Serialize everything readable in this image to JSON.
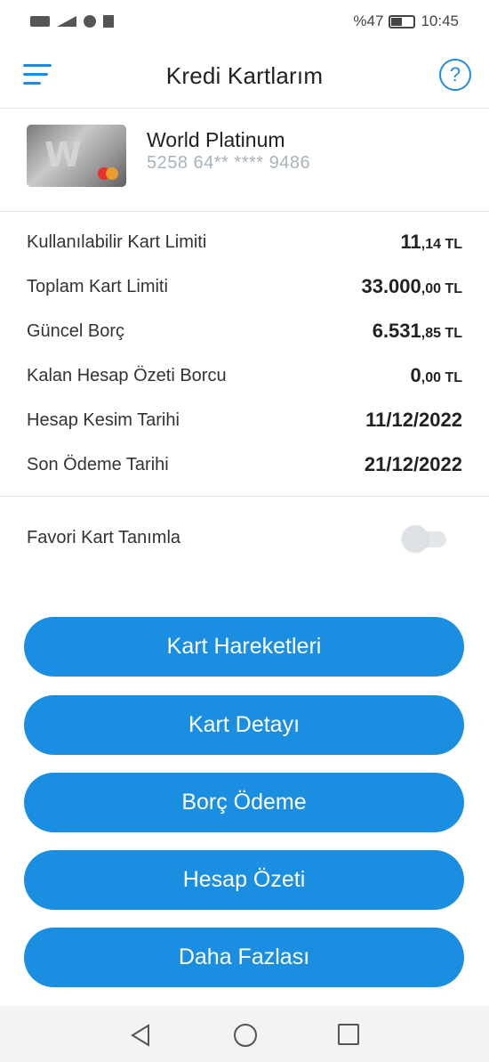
{
  "status_bar": {
    "battery": "%47",
    "time": "10:45"
  },
  "header": {
    "title": "Kredi Kartlarım",
    "help_symbol": "?"
  },
  "card": {
    "name": "World Platinum",
    "number": "5258 64** **** 9486"
  },
  "details": [
    {
      "label": "Kullanılabilir Kart Limiti",
      "main": "11",
      "small": ",14 TL"
    },
    {
      "label": "Toplam Kart Limiti",
      "main": "33.000",
      "small": ",00 TL"
    },
    {
      "label": "Güncel Borç",
      "main": "6.531",
      "small": ",85 TL"
    },
    {
      "label": "Kalan Hesap Özeti Borcu",
      "main": "0",
      "small": ",00 TL"
    },
    {
      "label": "Hesap Kesim Tarihi",
      "main": "11/12/2022",
      "small": ""
    },
    {
      "label": "Son Ödeme Tarihi",
      "main": "21/12/2022",
      "small": ""
    }
  ],
  "favorite": {
    "label": "Favori Kart Tanımla",
    "enabled": false
  },
  "actions": {
    "card_transactions": "Kart Hareketleri",
    "card_detail": "Kart Detayı",
    "debt_payment": "Borç Ödeme",
    "account_statement": "Hesap Özeti",
    "more": "Daha Fazlası"
  },
  "colors": {
    "accent": "#1a8ee1",
    "muted_text": "#a9b3bc"
  },
  "icons": {
    "menu": "hamburger-icon",
    "help": "question-circle-icon",
    "nav_back": "triangle-back-icon",
    "nav_home": "circle-home-icon",
    "nav_recent": "square-recent-icon"
  }
}
